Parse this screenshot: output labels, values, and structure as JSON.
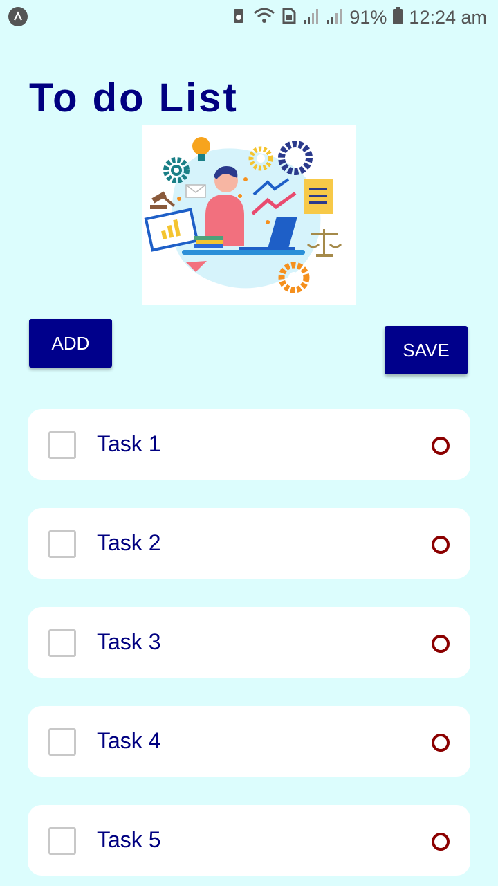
{
  "status_bar": {
    "battery": "91%",
    "time": "12:24 am"
  },
  "title": "To do List",
  "buttons": {
    "add": "ADD",
    "save": "SAVE"
  },
  "tasks": [
    {
      "label": "Task 1",
      "checked": false
    },
    {
      "label": "Task 2",
      "checked": false
    },
    {
      "label": "Task 3",
      "checked": false
    },
    {
      "label": "Task 4",
      "checked": false
    },
    {
      "label": "Task 5",
      "checked": false
    }
  ],
  "colors": {
    "background": "#dcfdfd",
    "title": "#000080",
    "button": "#00008b",
    "delete_marker": "#8b0000"
  }
}
